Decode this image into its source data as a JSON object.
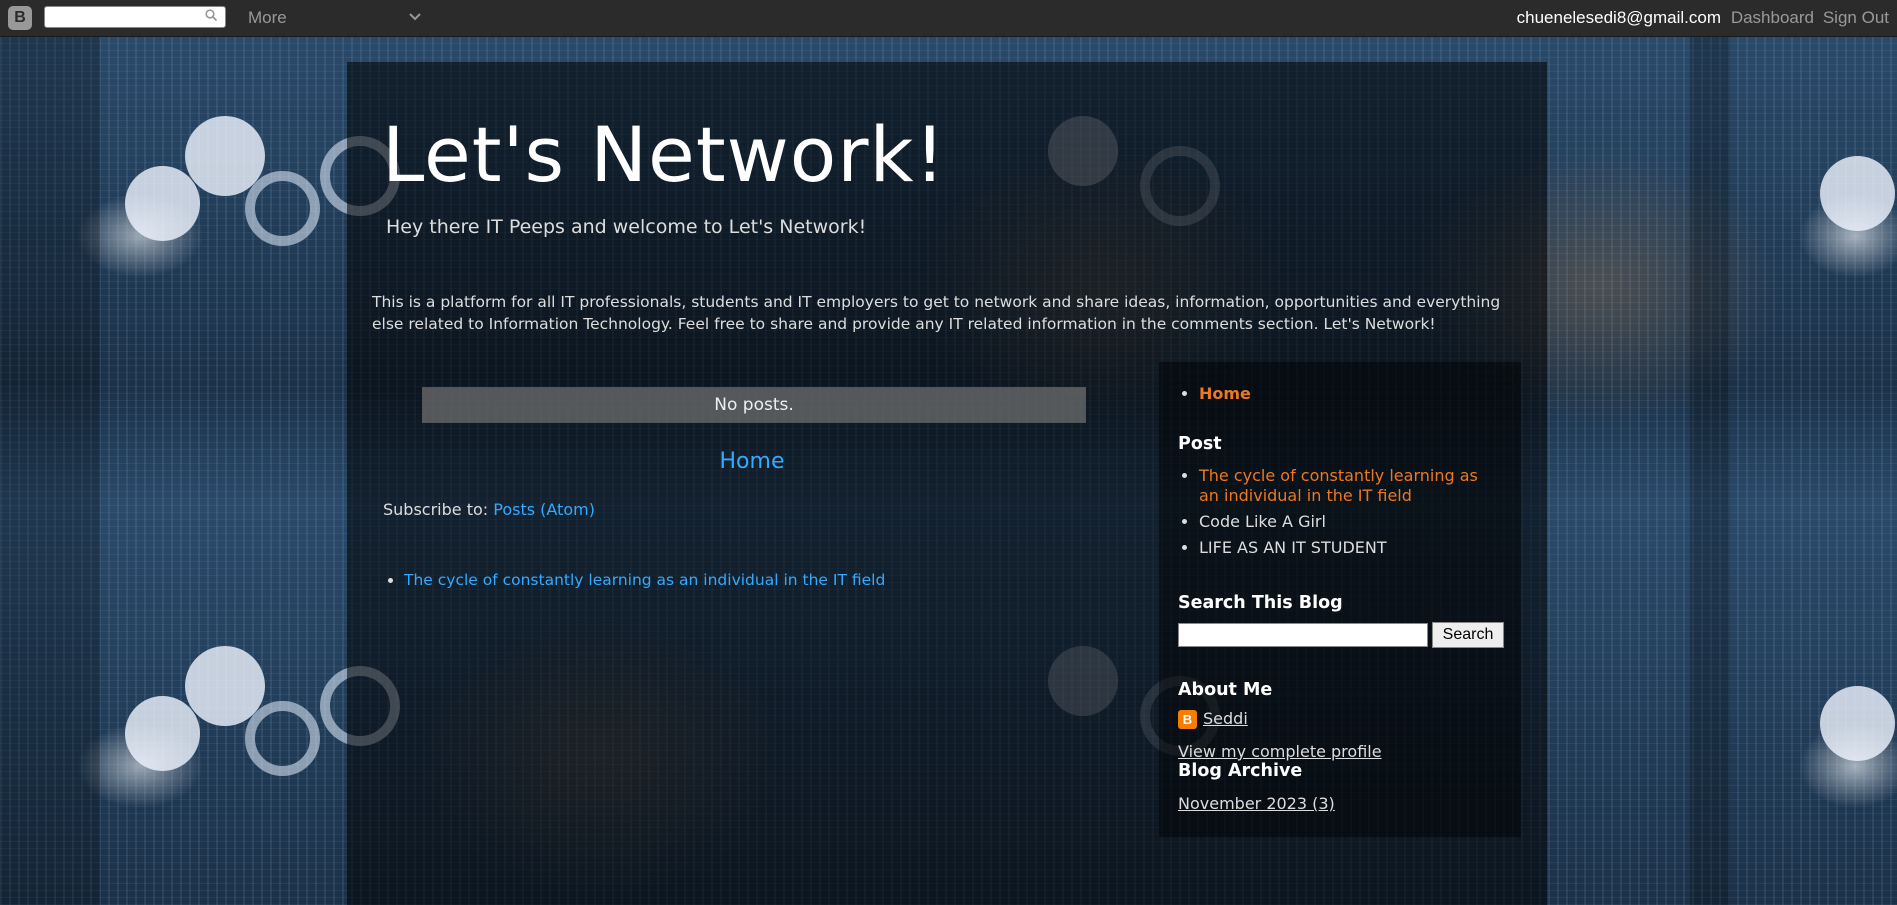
{
  "navbar": {
    "search_placeholder": "",
    "more_label": "More",
    "email": "chuenelesedi8@gmail.com",
    "dashboard_label": "Dashboard",
    "signout_label": "Sign Out"
  },
  "header": {
    "title": "Let's Network!",
    "description": "Hey there IT Peeps and welcome to Let's Network!"
  },
  "intro": {
    "text": "This is a platform for all IT professionals, students and IT employers to get to network and share ideas, information, opportunities and everything else related to Information Technology. Feel free to share and provide any IT related information in the comments section. Let's Network!"
  },
  "main": {
    "no_posts": "No posts.",
    "home_link": "Home",
    "subscribe_prefix": "Subscribe to:",
    "subscribe_link": "Posts (Atom)",
    "list_items": [
      "The cycle of constantly learning as an individual in the IT field"
    ]
  },
  "sidebar": {
    "pages": [
      "Home"
    ],
    "post_heading": "Post",
    "posts": [
      "The cycle of constantly learning as an individual in the IT field",
      "Code Like A Girl",
      "LIFE AS AN IT STUDENT"
    ],
    "search_heading": "Search This Blog",
    "search_button": "Search",
    "about_heading": "About Me",
    "profile_name": "Seddi",
    "profile_link": "View my complete profile",
    "archive_heading": "Blog Archive",
    "archive_entry": "November 2023 (3)"
  },
  "colors": {
    "link_blue": "#33aaff",
    "link_orange": "#ee7722",
    "navbar_bg": "#2b2b2b"
  }
}
